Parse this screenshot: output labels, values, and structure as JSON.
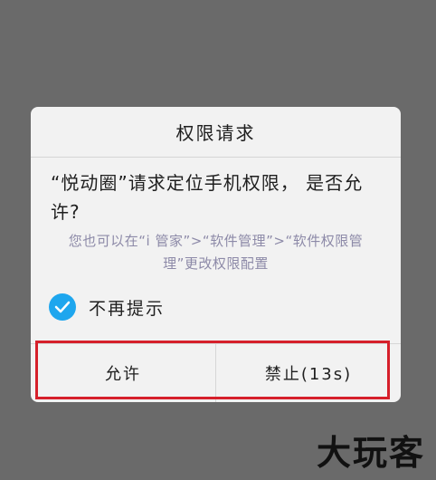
{
  "dialog": {
    "title": "权限请求",
    "message": "“悦动圈”请求定位手机权限， 是否允许?",
    "hint": "您也可以在“i 管家”>“软件管理”>“软件权限管理”更改权限配置",
    "checkbox_label": "不再提示",
    "checkbox_checked": true,
    "allow_label": "允许",
    "deny_label": "禁止(13s)"
  },
  "colors": {
    "checkbox": "#1ea6ee",
    "highlight": "#d6202b",
    "hint_text": "#8d8aa8"
  },
  "watermark": "大玩客"
}
